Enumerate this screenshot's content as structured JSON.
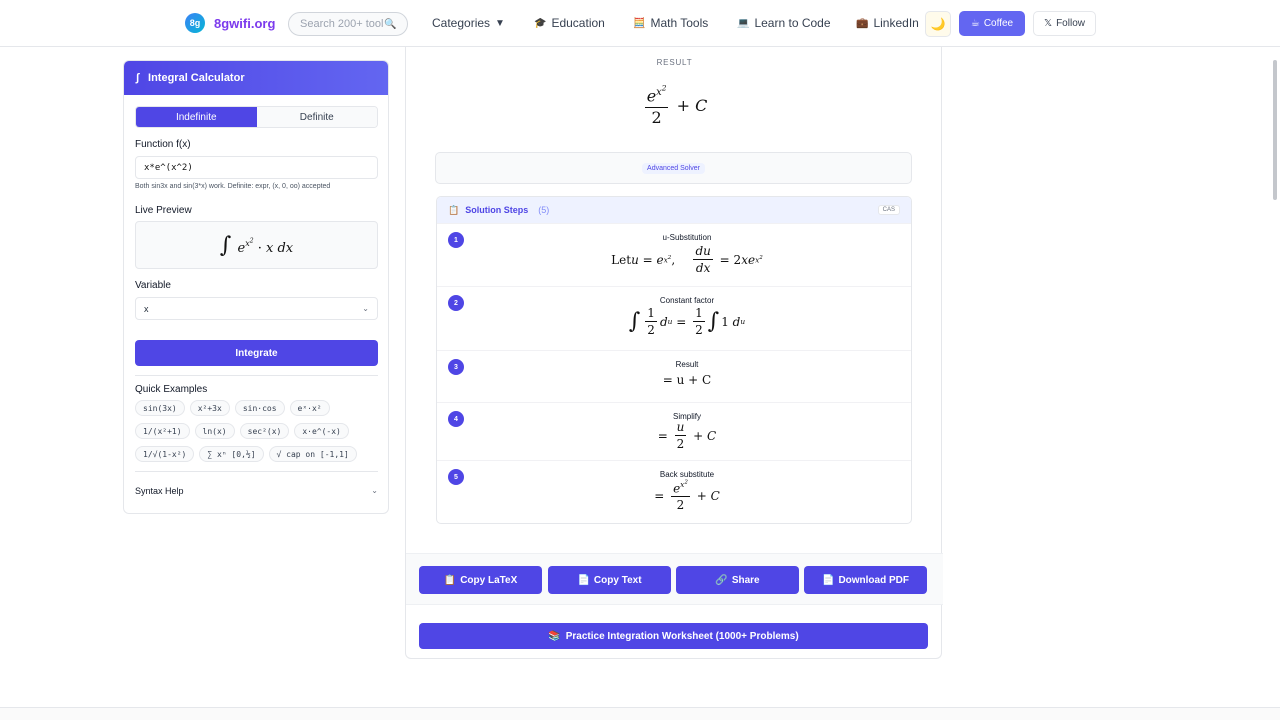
{
  "header": {
    "brand_logo": "8g",
    "brand_name": "8gwifi.org",
    "search_placeholder": "Search 200+ tools",
    "nav": [
      {
        "icon": "🎓",
        "label": "Education"
      },
      {
        "icon": "🧮",
        "label": "Math Tools"
      },
      {
        "icon": "💻",
        "label": "Learn to Code"
      },
      {
        "icon": "💼",
        "label": "LinkedIn"
      }
    ],
    "categories_label": "Categories",
    "categories_caret": "▼",
    "coffee_label": "Coffee",
    "coffee_icon": "☕",
    "follow_label": "Follow",
    "follow_icon": "𝕏"
  },
  "calculator": {
    "title": "Integral Calculator",
    "title_icon": "∫",
    "modes": [
      "Indefinite",
      "Definite"
    ],
    "active_mode": "Indefinite",
    "function_label": "Function f(x)",
    "function_value": "x*e^(x^2)",
    "hint": "Both sin3x and sin(3*x) work. Definite: expr, (x, 0, oo) accepted",
    "live_preview_label": "Live Preview",
    "variable_label": "Variable",
    "variable_value": "x",
    "integrate_label": "Integrate",
    "quick_examples_label": "Quick Examples",
    "examples": [
      [
        "sin(3x)",
        "x²+3x",
        "sin·cos",
        "eˣ·x²"
      ],
      [
        "1/(x²+1)",
        "ln(x)",
        "sec²(x)",
        "x·e^(-x)"
      ],
      [
        "1/√(1-x²)",
        "∑ xⁿ [0,½]",
        "√ cap on [-1,1]"
      ]
    ],
    "syntax_help_label": "Syntax Help"
  },
  "result": {
    "label": "RESULT",
    "advanced_solver_label": "Advanced Solver",
    "steps_title": "Solution Steps",
    "steps_count": "(5)",
    "cas_badge": "CAS",
    "steps": [
      {
        "num": "1",
        "title": "u-Substitution"
      },
      {
        "num": "2",
        "title": "Constant factor"
      },
      {
        "num": "3",
        "title": "Result"
      },
      {
        "num": "4",
        "title": "Simplify"
      },
      {
        "num": "5",
        "title": "Back substitute"
      }
    ],
    "actions": [
      {
        "icon": "📋",
        "label": "Copy LaTeX"
      },
      {
        "icon": "📄",
        "label": "Copy Text"
      },
      {
        "icon": "🔗",
        "label": "Share"
      },
      {
        "icon": "📄",
        "label": "Download PDF"
      }
    ],
    "practice_icon": "📚",
    "practice_label": "Practice Integration Worksheet (1000+ Problems)"
  }
}
